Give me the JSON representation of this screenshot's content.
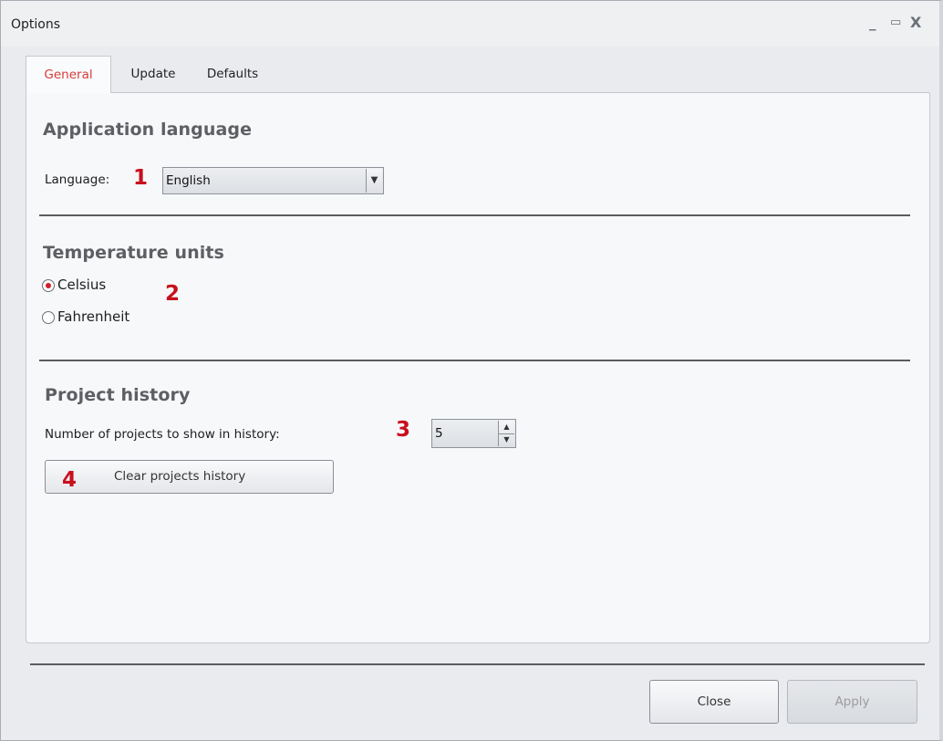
{
  "window": {
    "title": "Options",
    "controls": {
      "minimize": "_",
      "maximize": "▭",
      "close": "X"
    }
  },
  "tabs": [
    {
      "label": "General",
      "active": true
    },
    {
      "label": "Update",
      "active": false
    },
    {
      "label": "Defaults",
      "active": false
    }
  ],
  "general": {
    "language_section": {
      "heading": "Application language",
      "label": "Language:",
      "marker": "1",
      "selected": "English"
    },
    "temperature_section": {
      "heading": "Temperature units",
      "marker": "2",
      "options": [
        {
          "label": "Celsius",
          "checked": true
        },
        {
          "label": "Fahrenheit",
          "checked": false
        }
      ]
    },
    "history_section": {
      "heading": "Project history",
      "label": "Number of projects to show in history:",
      "marker": "3",
      "value": "5",
      "clear_marker": "4",
      "clear_label": "Clear projects history"
    }
  },
  "footer": {
    "close_label": "Close",
    "apply_label": "Apply",
    "apply_enabled": false
  },
  "colors": {
    "active_tab_text": "#d83a3a",
    "marker": "#c8101c",
    "radio_dot": "#d0202a"
  }
}
